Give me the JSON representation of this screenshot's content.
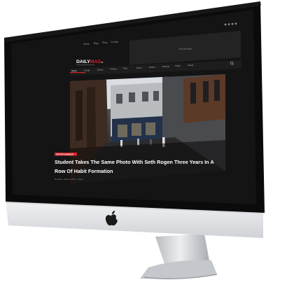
{
  "topbar": {
    "links": [
      "Home",
      "Blog",
      "Shop",
      "Contact"
    ],
    "social_icons": [
      "facebook-icon",
      "twitter-icon",
      "google-plus-icon",
      "instagram-icon"
    ]
  },
  "brand": {
    "logo_daily": "DAILY",
    "logo_mag": "MAG",
    "logo_suffix": "c",
    "tagline": "",
    "ad_text": "Your Ad here"
  },
  "nav": {
    "items": [
      "News",
      "World",
      "Sports",
      "Politics",
      "Tech",
      "Travel",
      "Health",
      "Lifestyle",
      "Crafts",
      "Latest"
    ],
    "active_index": 0,
    "search_icon": "search-icon"
  },
  "hero": {
    "category": "ENTERTAINMENT",
    "title_line1": "Student Takes The Same Photo With Seth Rogen Three Years In A",
    "title_line2": "Row Of Habit Formation",
    "meta": "By Author · May 14, 2018 · 2 Views"
  },
  "device": {
    "logo_icon": "apple-logo-icon"
  },
  "colors": {
    "accent": "#d8232a",
    "screen": "#141414",
    "bezel": "#0b0b0b",
    "chin": "#e3e4e6",
    "stand": "#cfd1d4"
  }
}
